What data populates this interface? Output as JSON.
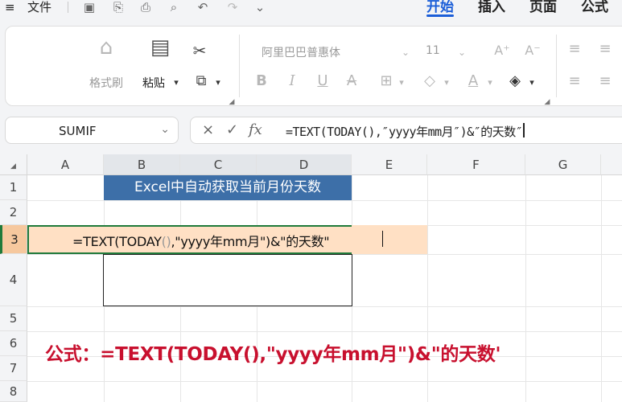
{
  "menu": {
    "file_label": "文件",
    "tabs": [
      "开始",
      "插入",
      "页面",
      "公式"
    ],
    "active_tab": "开始"
  },
  "ribbon": {
    "format_painter_label": "格式刷",
    "paste_label": "粘贴",
    "font_name": "阿里巴巴普惠体",
    "font_size": "11",
    "bold_label": "B",
    "italic_label": "I",
    "underline_label": "U",
    "strike_label": "A",
    "font_color_label": "A",
    "increase_font_label": "A⁺",
    "decrease_font_label": "A⁻"
  },
  "formula_bar": {
    "name_box": "SUMIF",
    "cancel_label": "×",
    "confirm_label": "✓",
    "fx_label": "fx",
    "formula": "=TEXT(TODAY(),″yyyy年mm月″)&″的天数″"
  },
  "grid": {
    "columns": [
      "A",
      "B",
      "C",
      "D",
      "E",
      "F",
      "G"
    ],
    "rows": [
      "1",
      "2",
      "3",
      "4",
      "5",
      "6",
      "7",
      "8"
    ],
    "title_cell": "Excel中自动获取当前月份天数",
    "edit_pre": "=TEXT(TODAY",
    "edit_paren": "()",
    "edit_post": ",\"yyyy年mm月\")&\"的天数\"",
    "caption": "公式：=TEXT(TODAY(),\"yyyy年mm月\")&\"的天数'"
  },
  "colors": {
    "accent": "#1b5ed8",
    "title_fill": "#3d6fa8",
    "edit_fill": "#ffe0c4",
    "selection_border": "#1f7a3a",
    "caption": "#c8102e"
  }
}
